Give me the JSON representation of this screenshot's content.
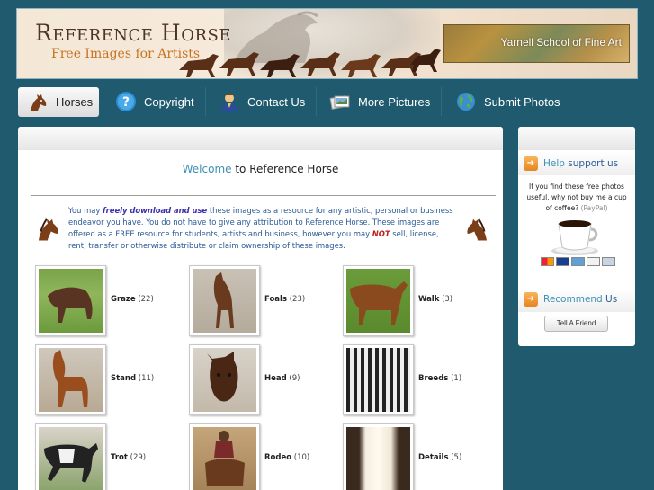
{
  "header": {
    "site_title": "Reference Horse",
    "tagline": "Free Images for Artists",
    "sponsor": "Yarnell School of Fine Art"
  },
  "nav": {
    "items": [
      {
        "label": "Horses",
        "icon": "horse-head-icon",
        "active": true
      },
      {
        "label": "Copyright",
        "icon": "question-icon",
        "active": false
      },
      {
        "label": "Contact Us",
        "icon": "person-icon",
        "active": false
      },
      {
        "label": "More Pictures",
        "icon": "photos-icon",
        "active": false
      },
      {
        "label": "Submit Photos",
        "icon": "globe-icon",
        "active": false
      }
    ]
  },
  "main": {
    "welcome_prefix": "Welcome",
    "welcome_rest": " to Reference Horse",
    "intro": {
      "p1": "You may ",
      "free": "freely download and use",
      "p2": " these images as a resource for any artistic, personal or business endeavor you have. You do not have to give any attribution to Reference Horse. These images are offered as a FREE resource for students, artists and business, however you may ",
      "not": "NOT",
      "p3": " sell, license, rent, transfer or otherwise distribute or claim ownership of these images."
    },
    "categories": [
      {
        "name": "Graze",
        "count": "(22)"
      },
      {
        "name": "Foals",
        "count": "(23)"
      },
      {
        "name": "Walk",
        "count": "(3)"
      },
      {
        "name": "Stand",
        "count": "(11)"
      },
      {
        "name": "Head",
        "count": "(9)"
      },
      {
        "name": "Breeds",
        "count": "(1)"
      },
      {
        "name": "Trot",
        "count": "(29)"
      },
      {
        "name": "Rodeo",
        "count": "(10)"
      },
      {
        "name": "Details",
        "count": "(5)"
      }
    ]
  },
  "sidebar": {
    "help_title_1": "Help",
    "help_title_2": " support us",
    "help_text": "If you find these free photos useful, why not buy me a cup of coffee?",
    "paypal": "(PayPal)",
    "recommend_title_1": "Recommend",
    "recommend_title_2": " Us",
    "tell_friend": "Tell A Friend"
  },
  "colors": {
    "page_bg": "#1f5a6e",
    "accent_blue": "#3c8fb5",
    "link_blue": "#2a5a96",
    "warning_red": "#c21d1d"
  }
}
